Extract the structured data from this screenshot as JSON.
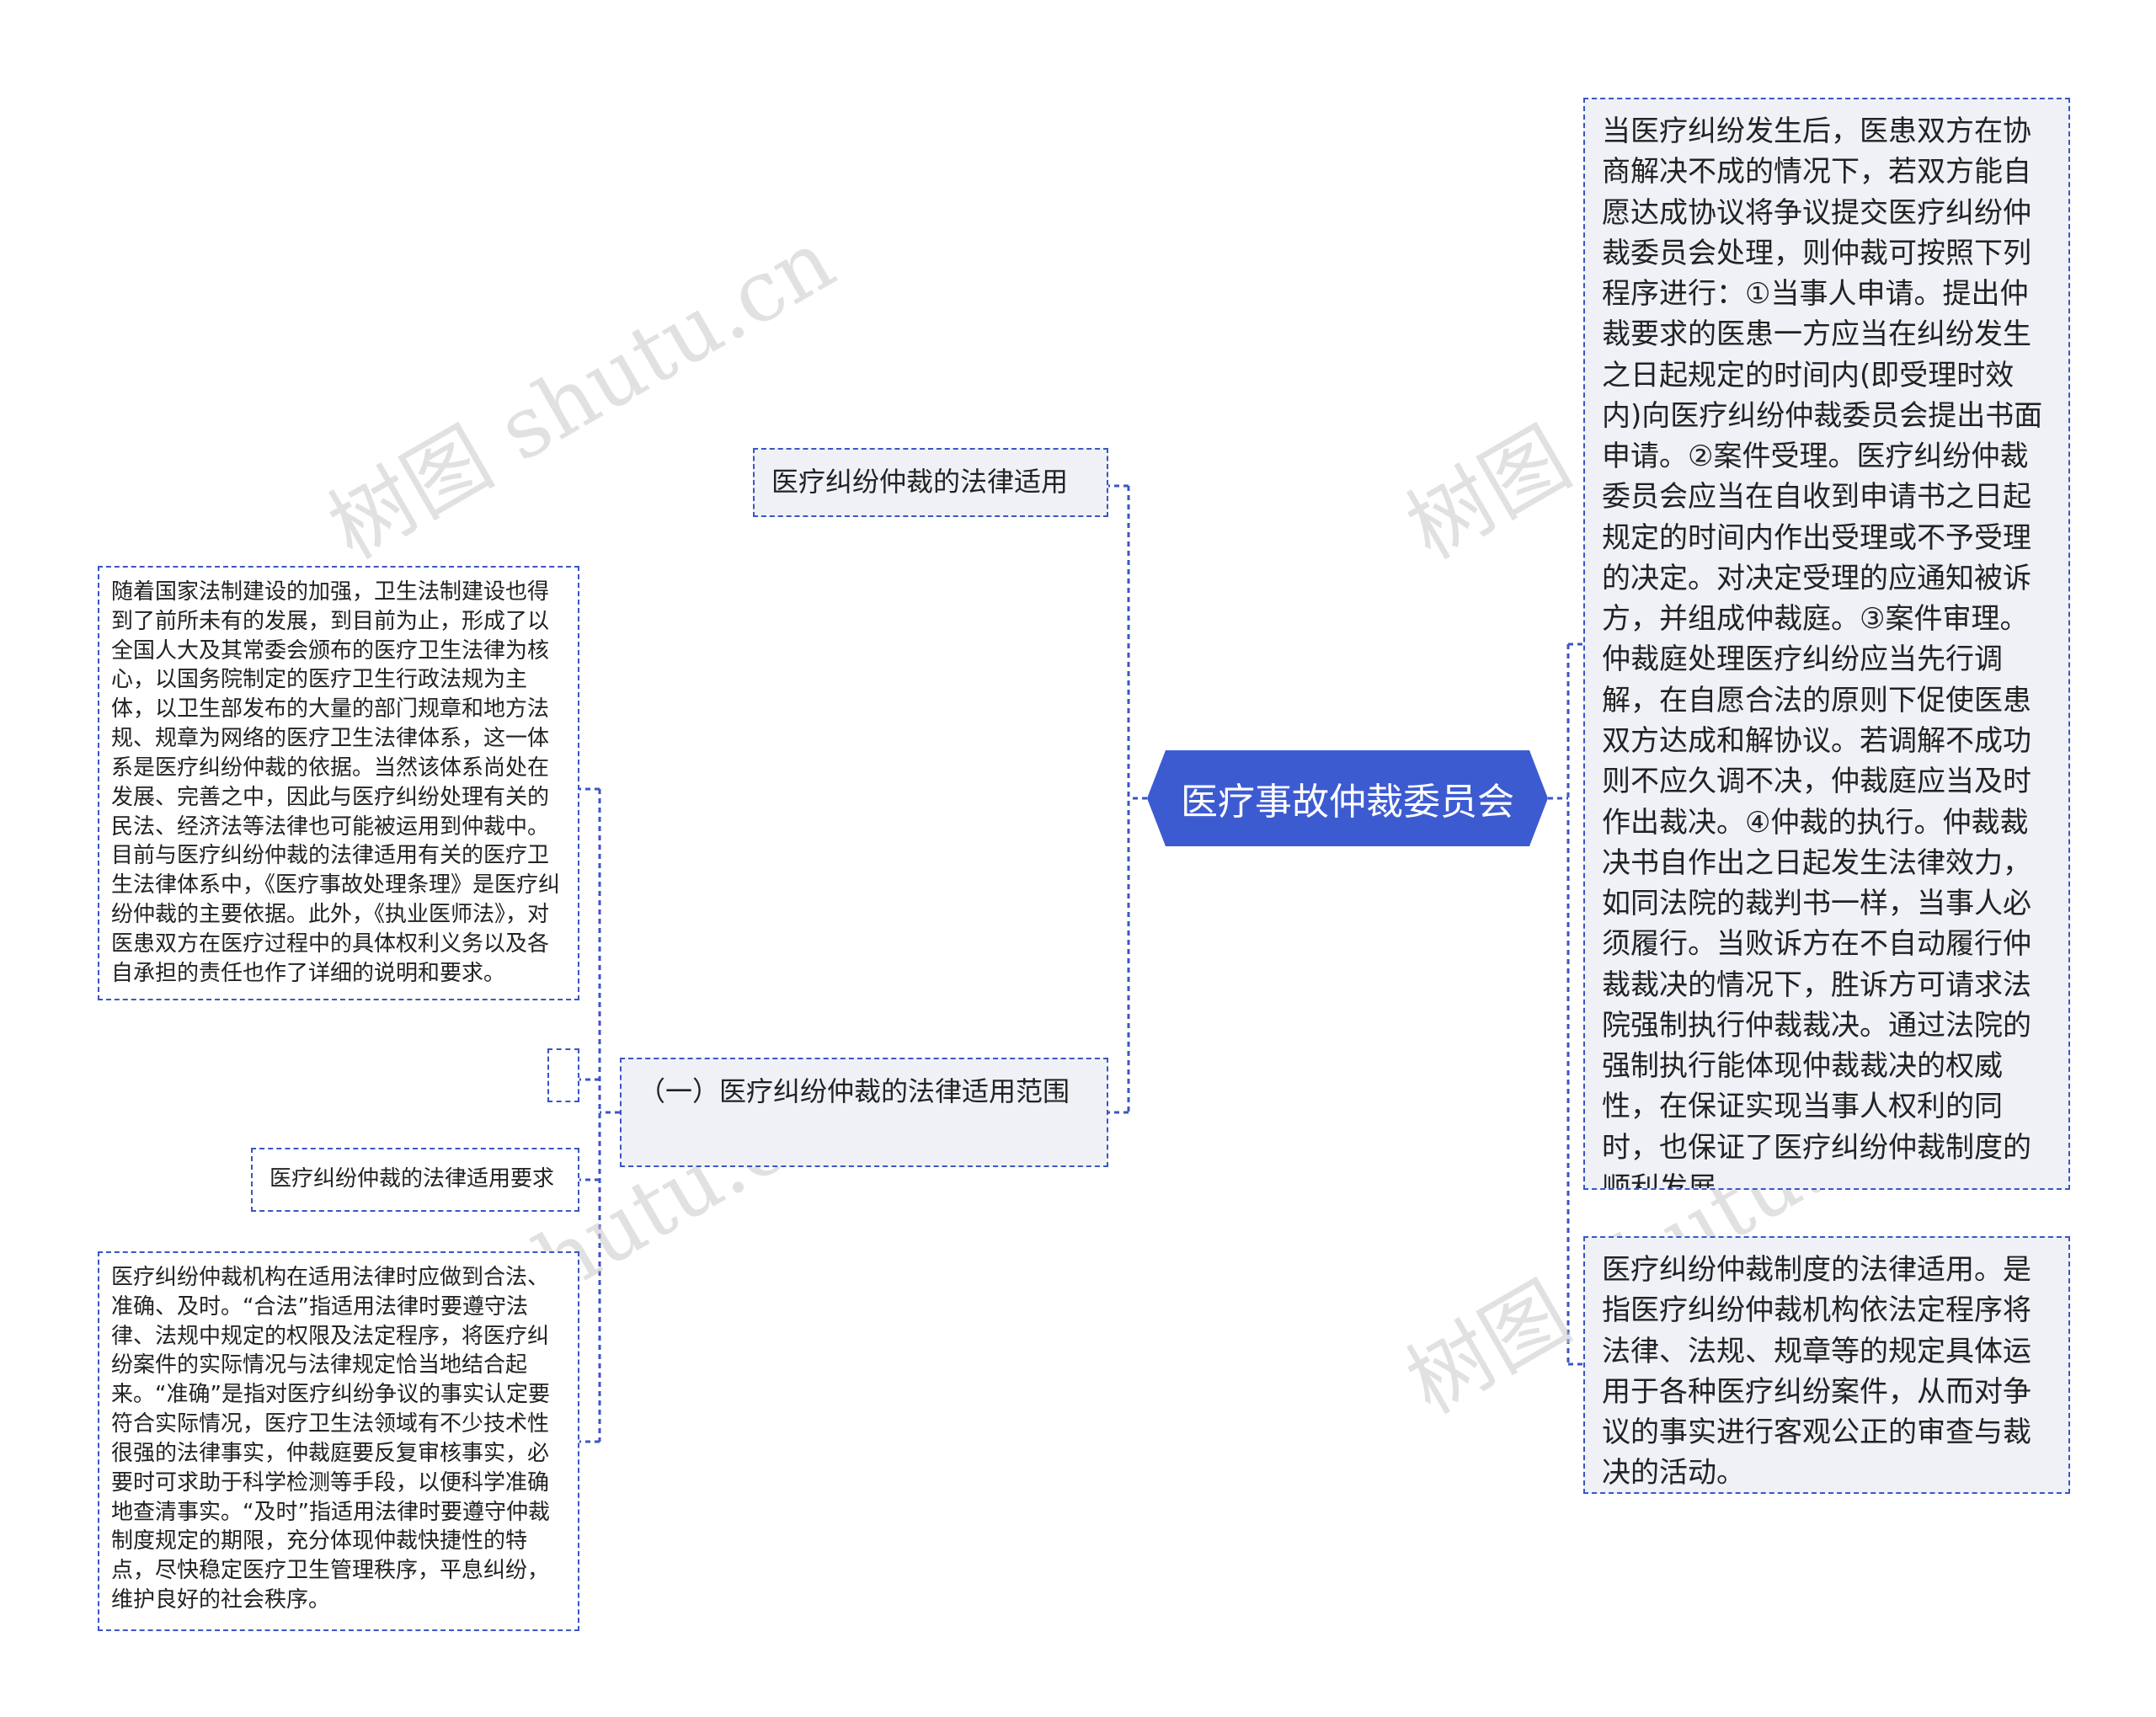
{
  "watermark": "树图 shutu.cn",
  "center": "医疗事故仲裁委员会",
  "right": {
    "procedure": "当医疗纠纷发生后，医患双方在协商解决不成的情况下，若双方能自愿达成协议将争议提交医疗纠纷仲裁委员会处理，则仲裁可按照下列程序进行：①当事人申请。提出仲裁要求的医患一方应当在纠纷发生之日起规定的时间内(即受理时效内)向医疗纠纷仲裁委员会提出书面申请。②案件受理。医疗纠纷仲裁委员会应当在自收到申请书之日起规定的时间内作出受理或不予受理的决定。对决定受理的应通知被诉方，并组成仲裁庭。③案件审理。仲裁庭处理医疗纠纷应当先行调解，在自愿合法的原则下促使医患双方达成和解协议。若调解不成功则不应久调不决，仲裁庭应当及时作出裁决。④仲裁的执行。仲裁裁决书自作出之日起发生法律效力，如同法院的裁判书一样，当事人必须履行。当败诉方在不自动履行仲裁裁决的情况下，胜诉方可请求法院强制执行仲裁裁决。通过法院的强制执行能体现仲裁裁决的权威性，在保证实现当事人权利的同时，也保证了医疗纠纷仲裁制度的顺利发展。",
    "definition": "医疗纠纷仲裁制度的法律适用。是指医疗纠纷仲裁机构依法定程序将法律、法规、规章等的规定具体运用于各种医疗纠纷案件，从而对争议的事实进行客观公正的审查与裁决的活动。"
  },
  "left": {
    "law_title": "医疗纠纷仲裁的法律适用",
    "scope_title": "（一）医疗纠纷仲裁的法律适用范围",
    "scope_text": "随着国家法制建设的加强，卫生法制建设也得到了前所未有的发展，到目前为止，形成了以全国人大及其常委会颁布的医疗卫生法律为核心，以国务院制定的医疗卫生行政法规为主体，以卫生部发布的大量的部门规章和地方法规、规章为网络的医疗卫生法律体系，这一体系是医疗纠纷仲裁的依据。当然该体系尚处在发展、完善之中，因此与医疗纠纷处理有关的民法、经济法等法律也可能被运用到仲裁中。目前与医疗纠纷仲裁的法律适用有关的医疗卫生法律体系中，《医疗事故处理条理》是医疗纠纷仲裁的主要依据。此外，《执业医师法》，对医患双方在医疗过程中的具体权利义务以及各自承担的责任也作了详细的说明和要求。",
    "empty_node": "",
    "req_title": "医疗纠纷仲裁的法律适用要求",
    "req_text": "医疗纠纷仲裁机构在适用法律时应做到合法、准确、及时。“合法”指适用法律时要遵守法律、法规中规定的权限及法定程序，将医疗纠纷案件的实际情况与法律规定恰当地结合起来。“准确”是指对医疗纠纷争议的事实认定要符合实际情况，医疗卫生法领域有不少技术性很强的法律事实，仲裁庭要反复审核事实，必要时可求助于科学检测等手段，以便科学准确地查清事实。“及时”指适用法律时要遵守仲裁制度规定的期限，充分体现仲裁快捷性的特点，尽快稳定医疗卫生管理秩序，平息纠纷，维护良好的社会秩序。"
  },
  "colors": {
    "accent": "#3d5bd1",
    "line": "#3b56c2",
    "node_fill": "#eff1f7"
  }
}
